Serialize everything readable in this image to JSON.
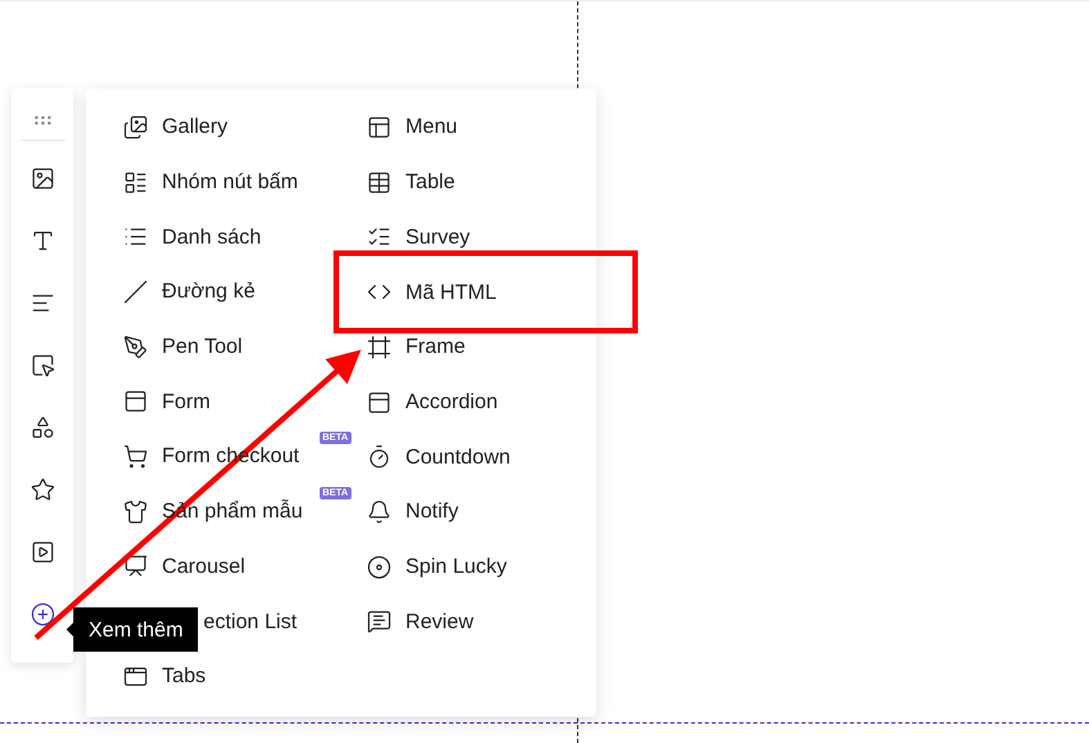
{
  "sidebar": {
    "items": [
      {
        "kind": "grip"
      },
      {
        "kind": "image",
        "selected": false
      },
      {
        "kind": "text",
        "selected": false
      },
      {
        "kind": "paragraph",
        "selected": false
      },
      {
        "kind": "select",
        "selected": false
      },
      {
        "kind": "shapes",
        "selected": false
      },
      {
        "kind": "star",
        "selected": false
      },
      {
        "kind": "video",
        "selected": false
      },
      {
        "kind": "more",
        "selected": true
      }
    ],
    "tooltip": "Xem thêm"
  },
  "menu": {
    "columns": [
      [
        {
          "kind": "gallery",
          "label": "Gallery"
        },
        {
          "kind": "buttons",
          "label": "Nhóm nút bấm"
        },
        {
          "kind": "list",
          "label": "Danh sách"
        },
        {
          "kind": "line",
          "label": "Đường kẻ"
        },
        {
          "kind": "pen",
          "label": "Pen Tool"
        },
        {
          "kind": "form",
          "label": "Form"
        },
        {
          "kind": "cart",
          "label": "Form checkout",
          "badge": "BETA"
        },
        {
          "kind": "product",
          "label": "Sản phẩm mẫu",
          "badge": "BETA"
        },
        {
          "kind": "carousel",
          "label": "Carousel"
        },
        {
          "kind": "section",
          "label": "ection List"
        },
        {
          "kind": "tabs",
          "label": "Tabs"
        }
      ],
      [
        {
          "kind": "menu",
          "label": "Menu"
        },
        {
          "kind": "table",
          "label": "Table"
        },
        {
          "kind": "survey",
          "label": "Survey"
        },
        {
          "kind": "code",
          "label": "Mã HTML",
          "highlighted": true
        },
        {
          "kind": "frame",
          "label": "Frame"
        },
        {
          "kind": "accordion",
          "label": "Accordion"
        },
        {
          "kind": "timer",
          "label": "Countdown"
        },
        {
          "kind": "bell",
          "label": "Notify"
        },
        {
          "kind": "spin",
          "label": "Spin Lucky"
        },
        {
          "kind": "review",
          "label": "Review"
        }
      ]
    ]
  }
}
